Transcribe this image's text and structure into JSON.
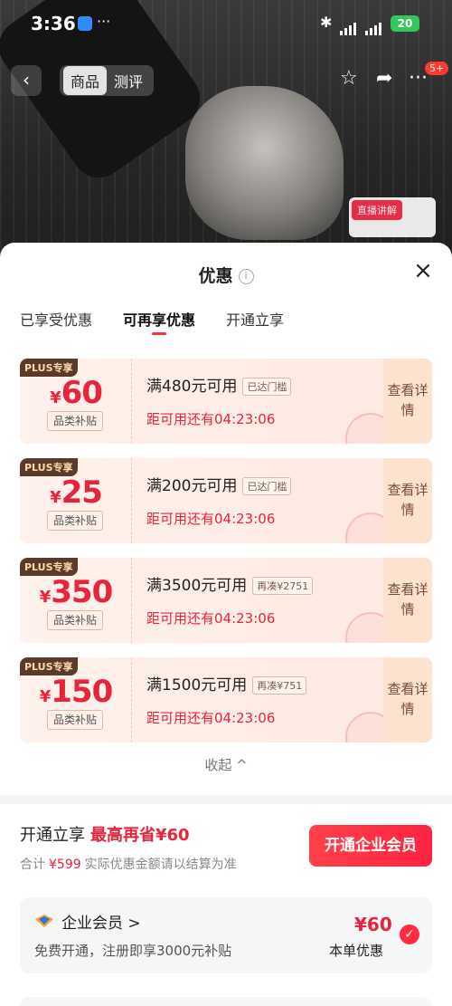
{
  "status_bar": {
    "time": "3:36",
    "overflow": "···",
    "battery": "20",
    "bluetooth_icon": "bluetooth-icon"
  },
  "nav": {
    "back_icon": "chevron-left-icon",
    "tabs": [
      {
        "label": "商品",
        "active": true
      },
      {
        "label": "测评",
        "active": false
      }
    ],
    "favorite_icon": "star-icon",
    "share_icon": "share-icon",
    "more_icon": "more-icon",
    "more_badge": "5+"
  },
  "backdrop": {
    "live_label": "直播讲解"
  },
  "sheet": {
    "title": "优惠",
    "info_icon": "i",
    "close_icon": "×",
    "tabs": [
      {
        "label": "已享受优惠",
        "active": false
      },
      {
        "label": "可再享优惠",
        "active": true
      },
      {
        "label": "开通立享",
        "active": false
      }
    ]
  },
  "coupons": [
    {
      "badge": "PLUS专享",
      "currency": "¥",
      "amount": "60",
      "category": "品类补贴",
      "condition": "满480元可用",
      "tag": "已达门槛",
      "countdown": "距可用还有04:23:06",
      "detail": "查看详情"
    },
    {
      "badge": "PLUS专享",
      "currency": "¥",
      "amount": "25",
      "category": "品类补贴",
      "condition": "满200元可用",
      "tag": "已达门槛",
      "countdown": "距可用还有04:23:06",
      "detail": "查看详情"
    },
    {
      "badge": "PLUS专享",
      "currency": "¥",
      "amount": "350",
      "category": "品类补贴",
      "condition": "满3500元可用",
      "tag": "再凑¥2751",
      "countdown": "距可用还有04:23:06",
      "detail": "查看详情"
    },
    {
      "badge": "PLUS专享",
      "currency": "¥",
      "amount": "150",
      "category": "品类补贴",
      "condition": "满1500元可用",
      "tag": "再凑¥751",
      "countdown": "距可用还有04:23:06",
      "detail": "查看详情"
    }
  ],
  "collapse_label": "收起 ^",
  "vip": {
    "title": "开通立享",
    "max_save": "最高再省¥60",
    "total_label": "合计",
    "total_price": "¥599",
    "note": "实际优惠金额请以结算为准",
    "button": "开通企业会员"
  },
  "member_card": {
    "name": "企业会员 >",
    "desc": "免费开通，注册即享3000元补贴",
    "amount": "¥60",
    "order_label": "本单优惠",
    "check_icon": "check-circle-icon"
  },
  "colors": {
    "accent_red": "#e8243b",
    "coupon_bg": "#fde9e0",
    "plus_badge": "#5a3a2b"
  }
}
